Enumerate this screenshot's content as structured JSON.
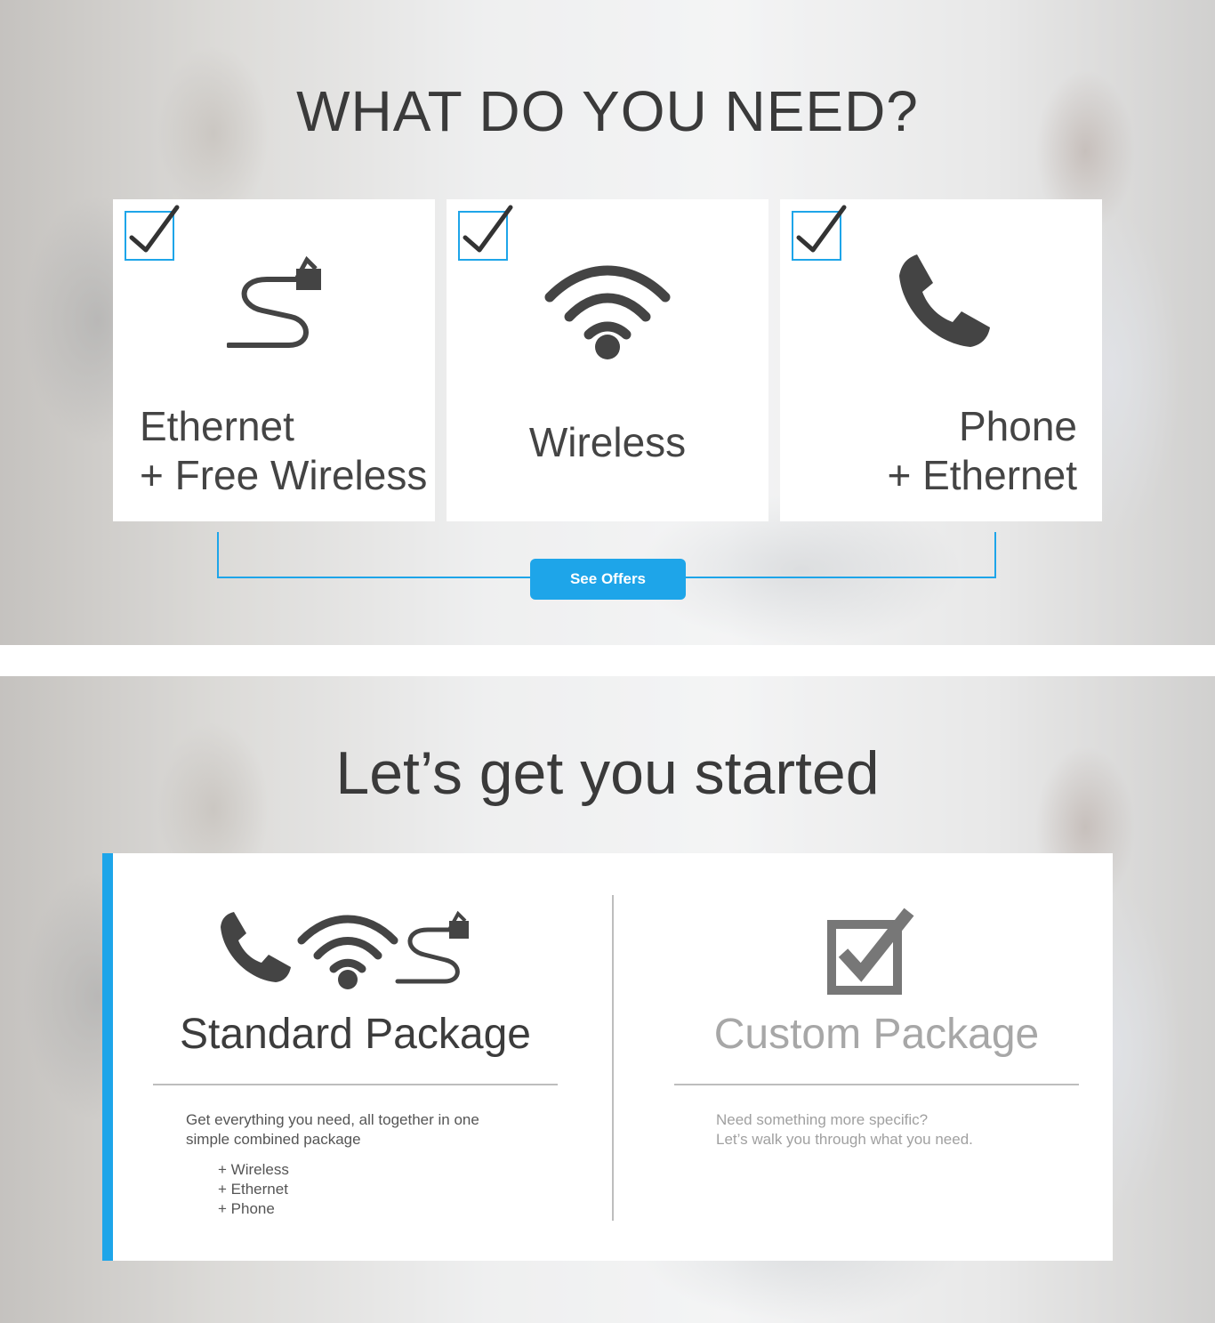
{
  "top": {
    "heading": "WHAT DO YOU NEED?",
    "cards": [
      {
        "line1": "Ethernet",
        "line2": "+ Free Wireless",
        "icon": "ethernet-cable-icon",
        "checked": true
      },
      {
        "line1": "Wireless",
        "line2": "",
        "icon": "wifi-icon",
        "checked": true
      },
      {
        "line1": "Phone",
        "line2": "+ Ethernet",
        "icon": "phone-icon",
        "checked": true
      }
    ],
    "cta": "See Offers"
  },
  "bottom": {
    "heading": "Let’s get you started",
    "standard": {
      "title": "Standard Package",
      "desc1": "Get everything you need, all together in one",
      "desc2": "simple combined package",
      "features": [
        "+ Wireless",
        "+ Ethernet",
        "+ Phone"
      ]
    },
    "custom": {
      "title": "Custom Package",
      "desc1": "Need something more specific?",
      "desc2": "Let’s walk you through what you need."
    }
  },
  "colors": {
    "accent": "#1ea5e9",
    "icon": "#444444",
    "muted": "#a7a7a7"
  }
}
